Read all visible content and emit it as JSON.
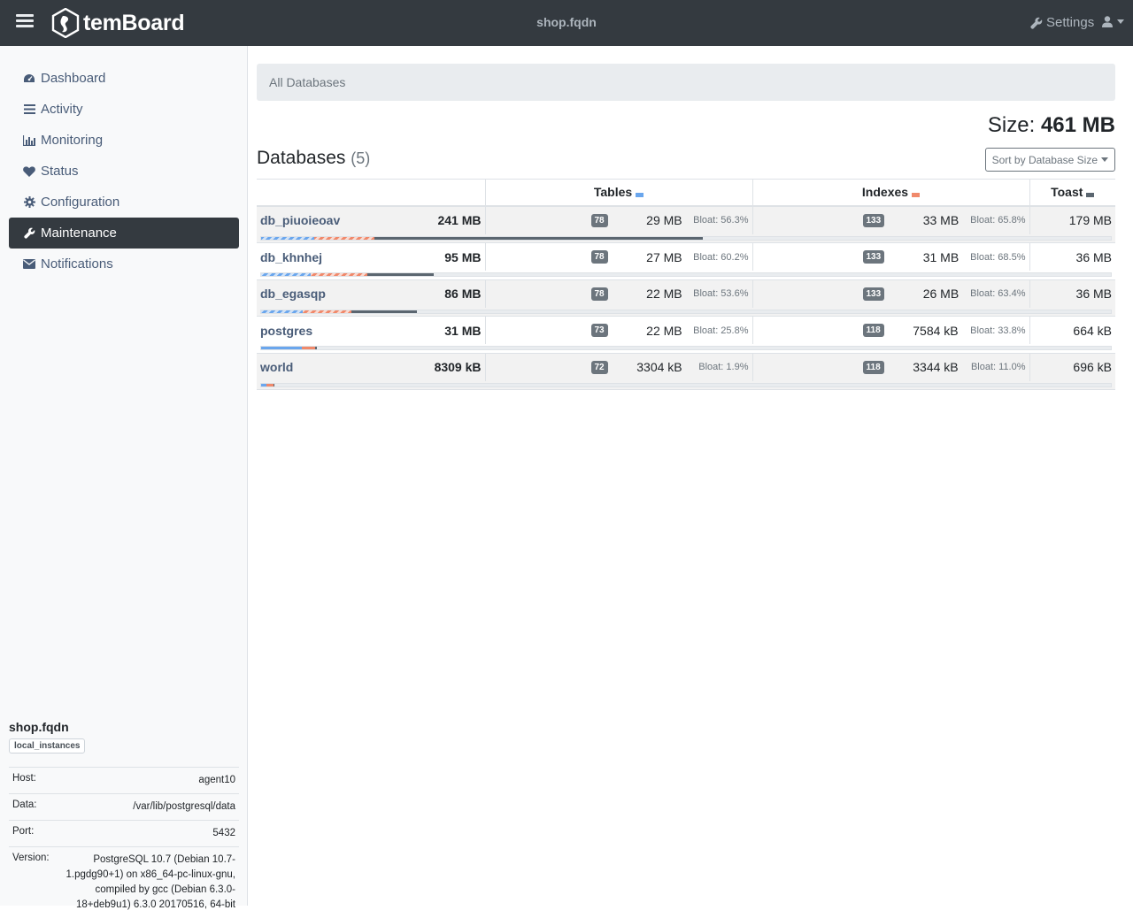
{
  "app": {
    "brand": "temBoard",
    "instance_title": "shop.fqdn"
  },
  "topnav": {
    "settings_label": "Settings"
  },
  "sidebar": {
    "items": [
      {
        "label": "Dashboard",
        "icon": "dashboard-icon"
      },
      {
        "label": "Activity",
        "icon": "list-icon"
      },
      {
        "label": "Monitoring",
        "icon": "bar-chart-icon"
      },
      {
        "label": "Status",
        "icon": "heart-icon"
      },
      {
        "label": "Configuration",
        "icon": "gear-icon"
      },
      {
        "label": "Maintenance",
        "icon": "wrench-icon",
        "active": true
      },
      {
        "label": "Notifications",
        "icon": "envelope-icon"
      }
    ],
    "instance": {
      "name": "shop.fqdn",
      "group": "local_instances",
      "host_label": "Host:",
      "host": "agent10",
      "data_label": "Data:",
      "data": "/var/lib/postgresql/data",
      "port_label": "Port:",
      "port": "5432",
      "version_label": "Version:",
      "version": "PostgreSQL 10.7 (Debian 10.7-1.pgdg90+1) on x86_64-pc-linux-gnu, compiled by gcc (Debian 6.3.0-18+deb9u1) 6.3.0 20170516, 64-bit"
    }
  },
  "main": {
    "breadcrumb": "All Databases",
    "size_label": "Size:",
    "size_value": "461 MB",
    "heading": "Databases",
    "heading_count": "(5)",
    "sort_label": "Sort by Database Size",
    "columns": {
      "tables": "Tables",
      "indexes": "Indexes",
      "toast": "Toast"
    },
    "colors": {
      "tables": "#6aa6ed",
      "indexes": "#f0896b",
      "toast": "#5b6670"
    },
    "databases": [
      {
        "name": "db_piuoieoav",
        "size": "241 MB",
        "tables_count": "78",
        "tables_size": "29 MB",
        "tables_bloat": "Bloat: 56.3%",
        "indexes_count": "133",
        "indexes_size": "33 MB",
        "indexes_bloat": "Bloat: 65.8%",
        "toast_size": "179 MB"
      },
      {
        "name": "db_khnhej",
        "size": "95 MB",
        "tables_count": "78",
        "tables_size": "27 MB",
        "tables_bloat": "Bloat: 60.2%",
        "indexes_count": "133",
        "indexes_size": "31 MB",
        "indexes_bloat": "Bloat: 68.5%",
        "toast_size": "36 MB"
      },
      {
        "name": "db_egasqp",
        "size": "86 MB",
        "tables_count": "78",
        "tables_size": "22 MB",
        "tables_bloat": "Bloat: 53.6%",
        "indexes_count": "133",
        "indexes_size": "26 MB",
        "indexes_bloat": "Bloat: 63.4%",
        "toast_size": "36 MB"
      },
      {
        "name": "postgres",
        "size": "31 MB",
        "tables_count": "73",
        "tables_size": "22 MB",
        "tables_bloat": "Bloat: 25.8%",
        "indexes_count": "118",
        "indexes_size": "7584 kB",
        "indexes_bloat": "Bloat: 33.8%",
        "toast_size": "664 kB"
      },
      {
        "name": "world",
        "size": "8309 kB",
        "tables_count": "72",
        "tables_size": "3304 kB",
        "tables_bloat": "Bloat: 1.9%",
        "indexes_count": "118",
        "indexes_size": "3344 kB",
        "indexes_bloat": "Bloat: 11.0%",
        "toast_size": "696 kB"
      }
    ]
  }
}
